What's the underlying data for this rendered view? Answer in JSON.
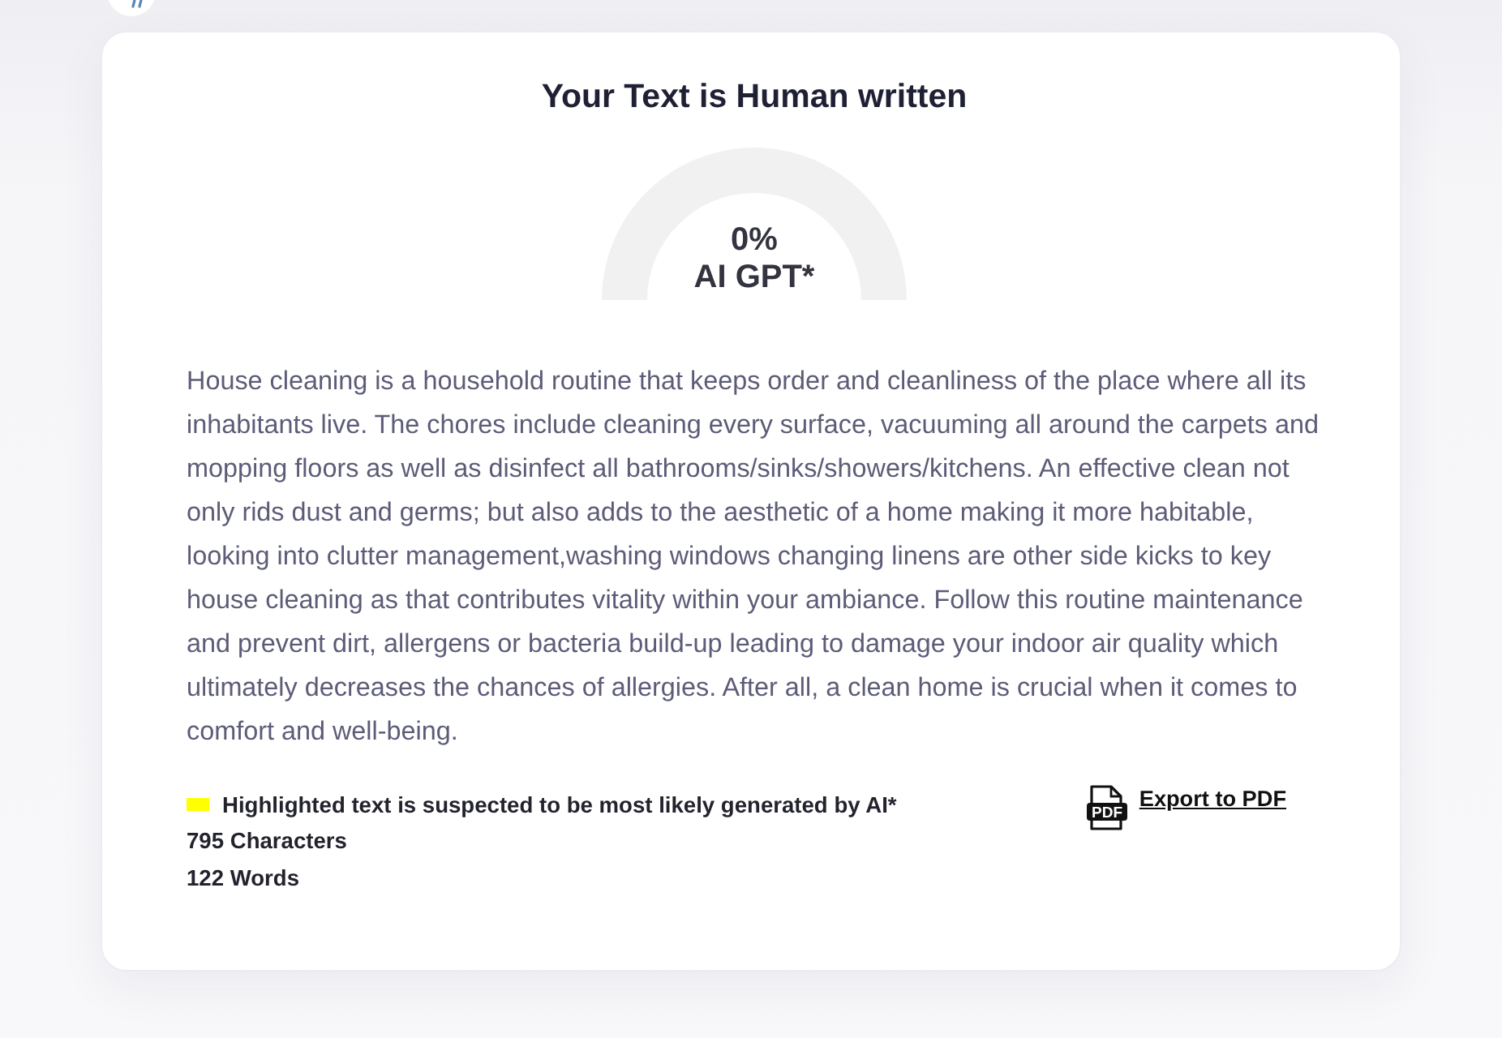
{
  "result": {
    "title": "Your Text is Human written",
    "gauge": {
      "percent": "0%",
      "label": "AI GPT*"
    },
    "analyzed_text": "House cleaning is a household routine that keeps order and cleanliness of the place where all its inhabitants live. The chores include cleaning every surface, vacuuming all around the carpets and mopping floors as well as disinfect all bathrooms/sinks/showers/kitchens. An effective clean not only rids dust and germs; but also adds to the aesthetic of a home making it more habitable, looking into clutter management,washing windows changing linens are other side kicks to key house cleaning as that contributes vitality within your ambiance. Follow this routine maintenance and prevent dirt, allergens or bacteria build-up leading to damage your indoor air quality which ultimately decreases the chances of allergies. After all, a clean home is crucial when it comes to comfort and well-being.",
    "legend": "Highlighted text is suspected to be most likely generated by AI*",
    "stats": [
      "795 Characters",
      "122 Words"
    ],
    "export": {
      "icon_text": "PDF",
      "label": "Export to PDF"
    }
  }
}
